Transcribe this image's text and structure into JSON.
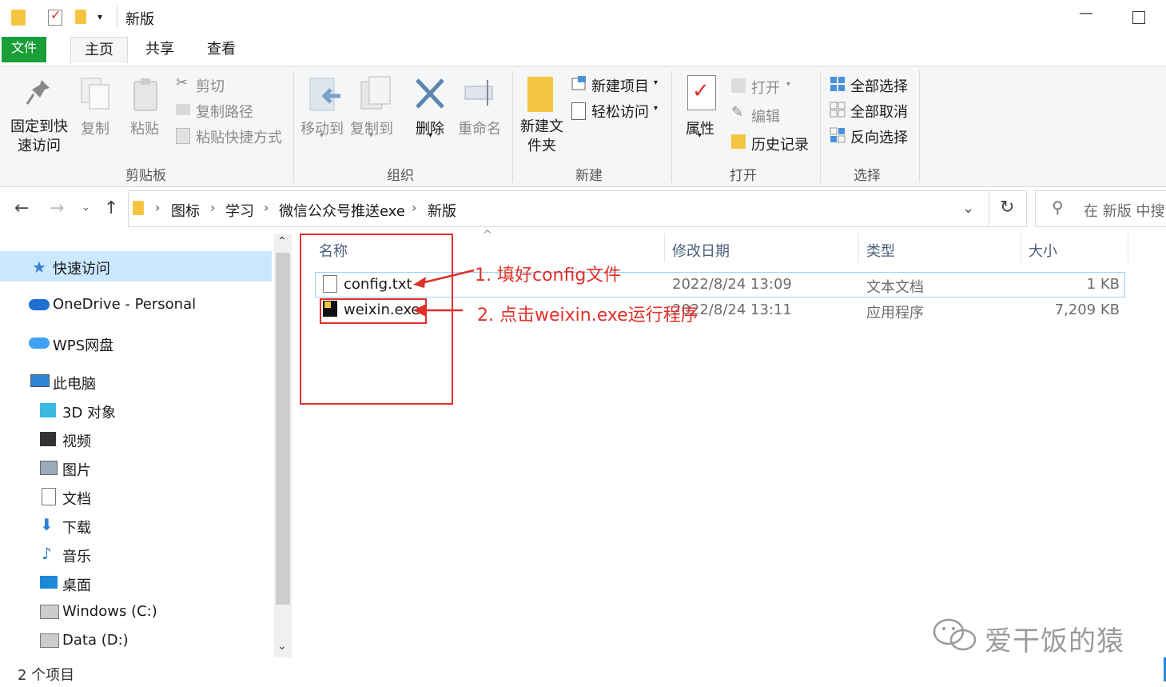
{
  "window": {
    "title": "新版"
  },
  "tabs": [
    "文件",
    "主页",
    "共享",
    "查看"
  ],
  "ribbon": {
    "pin": "固定到快速访问",
    "copy": "复制",
    "paste": "粘贴",
    "cut": "剪切",
    "copy_path": "复制路径",
    "paste_shortcut": "粘贴快捷方式",
    "clipboard": "剪贴板",
    "move_to": "移动到",
    "copy_to": "复制到",
    "delete": "删除",
    "rename": "重命名",
    "organize": "组织",
    "new_folder": "新建文件夹",
    "new_item": "新建项目",
    "easy_access": "轻松访问",
    "new_group": "新建",
    "properties": "属性",
    "open": "打开",
    "edit": "编辑",
    "history": "历史记录",
    "open_group": "打开",
    "select_all": "全部选择",
    "select_none": "全部取消",
    "invert": "反向选择",
    "select_group": "选择"
  },
  "address": {
    "crumbs": [
      "图标",
      "学习",
      "微信公众号推送exe",
      "新版"
    ],
    "search_placeholder": "在 新版 中搜索"
  },
  "nav": {
    "quick_access": "快速访问",
    "onedrive": "OneDrive - Personal",
    "wps": "WPS网盘",
    "this_pc": "此电脑",
    "items": [
      "3D 对象",
      "视频",
      "图片",
      "文档",
      "下载",
      "音乐",
      "桌面",
      "Windows (C:)",
      "Data (D:)"
    ]
  },
  "columns": {
    "name": "名称",
    "date": "修改日期",
    "type": "类型",
    "size": "大小"
  },
  "files": [
    {
      "name": "config.txt",
      "date": "2022/8/24 13:09",
      "type": "文本文档",
      "size": "1 KB"
    },
    {
      "name": "weixin.exe",
      "date": "2022/8/24 13:11",
      "type": "应用程序",
      "size": "7,209 KB"
    }
  ],
  "annotations": {
    "step1": "1. 填好config文件",
    "step2": "2. 点击weixin.exe运行程序"
  },
  "status": "2 个项目",
  "watermark": "爱干饭的猿",
  "colors": {
    "file_tab": "#1a9e38",
    "annotation": "#e0302a",
    "selected": "#cce8ff"
  }
}
